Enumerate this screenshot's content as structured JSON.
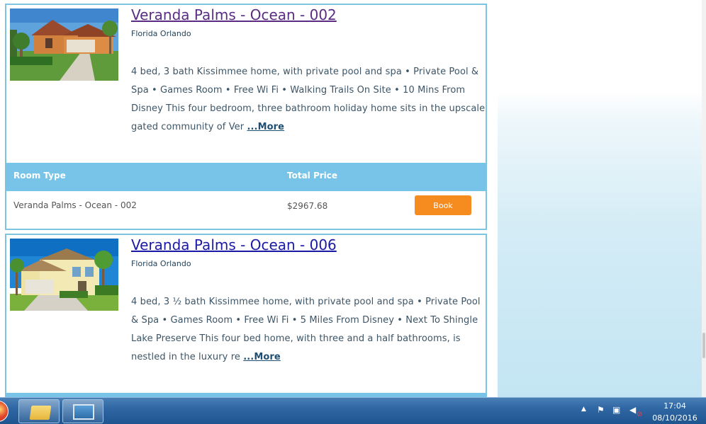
{
  "listings": [
    {
      "title": "Veranda Palms - Ocean - 002",
      "location": "Florida Orlando",
      "description": "4 bed, 3 bath Kissimmee home, with private pool and spa • Private Pool & Spa • Games Room • Free Wi Fi • Walking Trails On Site • 10 Mins From Disney This four bedroom, three bathroom holiday home sits in the upscale gated community of Ver ",
      "more_label": "...More",
      "table": {
        "col_room": "Room Type",
        "col_price": "Total Price",
        "room_type": "Veranda Palms - Ocean - 002",
        "total_price": "$2967.68",
        "book_label": "Book"
      }
    },
    {
      "title": "Veranda Palms - Ocean - 006",
      "location": "Florida Orlando",
      "description": "4 bed, 3 ½ bath Kissimmee home, with private pool and spa • Private Pool & Spa • Games Room • Free Wi Fi • 5 Miles From Disney • Next To Shingle Lake Preserve This four bed home, with three and a half bathrooms, is nestled in the luxury re ",
      "more_label": "...More"
    }
  ],
  "taskbar": {
    "time": "17:04",
    "date": "08/10/2016",
    "tray_icons": [
      "show-hidden-icons-arrow",
      "action-center-flag-icon",
      "network-icon",
      "volume-muted-icon"
    ]
  },
  "colors": {
    "card_border": "#7cc4df",
    "table_header": "#78c4e8",
    "book_button": "#f68b1f",
    "visited_link": "#5a2d82",
    "link": "#1a1aa6"
  }
}
